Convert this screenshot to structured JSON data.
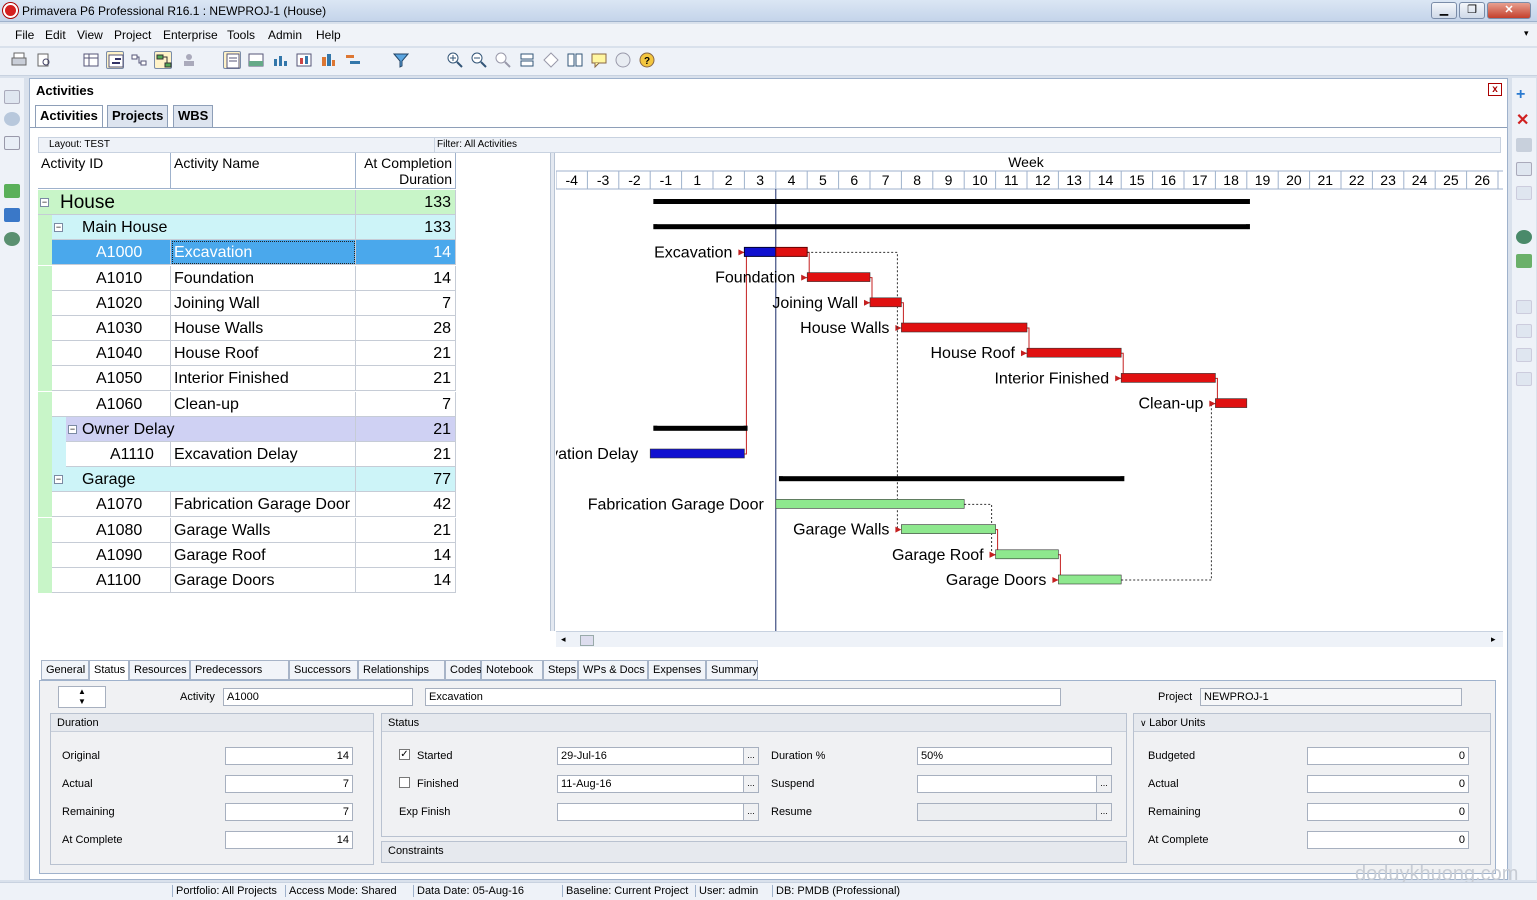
{
  "window": {
    "title": "Primavera P6 Professional R16.1 : NEWPROJ-1 (House)",
    "minimize": "▁",
    "restore": "❐",
    "close": "✕"
  },
  "menu": [
    "File",
    "Edit",
    "View",
    "Project",
    "Enterprise",
    "Tools",
    "Admin",
    "Help"
  ],
  "panel": {
    "title": "Activities",
    "close": "x",
    "tabs": [
      "Activities",
      "Projects",
      "WBS"
    ]
  },
  "layout": {
    "layout_label": "Layout: TEST",
    "filter_label": "Filter: All Activities"
  },
  "columns": {
    "id": "Activity ID",
    "name": "Activity Name",
    "duration": "At Completion Duration"
  },
  "rows": [
    {
      "type": "wbs",
      "level": 0,
      "label": "House",
      "dur": "133",
      "color": "#c8f5c8"
    },
    {
      "type": "wbs",
      "level": 1,
      "label": "Main House",
      "dur": "133",
      "color": "#cdf4f8"
    },
    {
      "type": "act",
      "level": 2,
      "id": "A1000",
      "name": "Excavation",
      "dur": "14",
      "selected": true
    },
    {
      "type": "act",
      "level": 2,
      "id": "A1010",
      "name": "Foundation",
      "dur": "14"
    },
    {
      "type": "act",
      "level": 2,
      "id": "A1020",
      "name": "Joining Wall",
      "dur": "7"
    },
    {
      "type": "act",
      "level": 2,
      "id": "A1030",
      "name": "House Walls",
      "dur": "28"
    },
    {
      "type": "act",
      "level": 2,
      "id": "A1040",
      "name": "House Roof",
      "dur": "21"
    },
    {
      "type": "act",
      "level": 2,
      "id": "A1050",
      "name": "Interior Finished",
      "dur": "21"
    },
    {
      "type": "act",
      "level": 2,
      "id": "A1060",
      "name": "Clean-up",
      "dur": "7"
    },
    {
      "type": "wbs",
      "level": 2,
      "label": "Owner Delay",
      "dur": "21",
      "color": "#cfd1f3"
    },
    {
      "type": "act",
      "level": 3,
      "id": "A1110",
      "name": "Excavation Delay",
      "dur": "21"
    },
    {
      "type": "wbs",
      "level": 1,
      "label": "Garage",
      "dur": "77",
      "color": "#cdf4f8"
    },
    {
      "type": "act",
      "level": 2,
      "id": "A1070",
      "name": "Fabrication Garage Door",
      "dur": "42"
    },
    {
      "type": "act",
      "level": 2,
      "id": "A1080",
      "name": "Garage Walls",
      "dur": "21"
    },
    {
      "type": "act",
      "level": 2,
      "id": "A1090",
      "name": "Garage Roof",
      "dur": "14"
    },
    {
      "type": "act",
      "level": 2,
      "id": "A1100",
      "name": "Garage Doors",
      "dur": "14"
    }
  ],
  "gantt": {
    "timescale_label": "Week",
    "weeks": [
      "-4",
      "-3",
      "-2",
      "-1",
      "1",
      "2",
      "3",
      "4",
      "5",
      "6",
      "7",
      "8",
      "9",
      "10",
      "11",
      "12",
      "13",
      "14",
      "15",
      "16",
      "17",
      "18",
      "19",
      "20",
      "21",
      "22",
      "23",
      "24",
      "25",
      "26",
      "2"
    ],
    "data_date_week": "4",
    "colors": {
      "actual": "#1010d0",
      "remaining": "#e01010",
      "garage": "#8ee88e",
      "summary": "#000000"
    },
    "bars": [
      {
        "row": 0,
        "kind": "summary",
        "start": -1,
        "end": 19
      },
      {
        "row": 1,
        "kind": "summary",
        "start": -1,
        "end": 19
      },
      {
        "row": 2,
        "kind": "split",
        "label": "Excavation",
        "start": 3,
        "mid": 4,
        "end": 5
      },
      {
        "row": 3,
        "kind": "remaining",
        "label": "Foundation",
        "start": 5,
        "end": 7
      },
      {
        "row": 4,
        "kind": "remaining",
        "label": "Joining Wall",
        "start": 7,
        "end": 8
      },
      {
        "row": 5,
        "kind": "remaining",
        "label": "House Walls",
        "start": 8,
        "end": 12
      },
      {
        "row": 6,
        "kind": "remaining",
        "label": "House Roof",
        "start": 12,
        "end": 15
      },
      {
        "row": 7,
        "kind": "remaining",
        "label": "Interior Finished",
        "start": 15,
        "end": 18
      },
      {
        "row": 8,
        "kind": "remaining",
        "label": "Clean-up",
        "start": 18,
        "end": 19
      },
      {
        "row": 9,
        "kind": "summary",
        "start": -1,
        "end": 3
      },
      {
        "row": 10,
        "kind": "actual",
        "label": "avation Delay",
        "start": -1,
        "end": 3
      },
      {
        "row": 11,
        "kind": "summary",
        "start": 4,
        "end": 15
      },
      {
        "row": 12,
        "kind": "garage",
        "label": "Fabrication Garage Door",
        "start": 4,
        "end": 10
      },
      {
        "row": 13,
        "kind": "garage",
        "label": "Garage Walls",
        "start": 8,
        "end": 11
      },
      {
        "row": 14,
        "kind": "garage",
        "label": "Garage Roof",
        "start": 11,
        "end": 13
      },
      {
        "row": 15,
        "kind": "garage",
        "label": "Garage Doors",
        "start": 13,
        "end": 15
      }
    ],
    "links": [
      [
        10,
        2
      ],
      [
        2,
        3
      ],
      [
        3,
        4
      ],
      [
        4,
        5
      ],
      [
        5,
        6
      ],
      [
        6,
        7
      ],
      [
        7,
        8
      ],
      [
        2,
        13
      ],
      [
        12,
        14
      ],
      [
        13,
        14
      ],
      [
        14,
        15
      ],
      [
        15,
        8
      ]
    ]
  },
  "detail": {
    "tabs": [
      "General",
      "Status",
      "Resources",
      "Predecessors",
      "Successors",
      "Relationships",
      "Codes",
      "Notebook",
      "Steps",
      "WPs & Docs",
      "Expenses",
      "Summary"
    ],
    "activity_label": "Activity",
    "activity_id": "A1000",
    "activity_name": "Excavation",
    "project_label": "Project",
    "project": "NEWPROJ-1",
    "duration": {
      "title": "Duration",
      "original_label": "Original",
      "original": "14",
      "actual_label": "Actual",
      "actual": "7",
      "remaining_label": "Remaining",
      "remaining": "7",
      "at_complete_label": "At Complete",
      "at_complete": "14"
    },
    "status": {
      "title": "Status",
      "started_label": "Started",
      "started": true,
      "started_date": "29-Jul-16",
      "finished_label": "Finished",
      "finished": false,
      "finished_date": "11-Aug-16",
      "exp_finish_label": "Exp Finish",
      "exp_finish": "",
      "duration_pct_label": "Duration %",
      "duration_pct": "50%",
      "suspend_label": "Suspend",
      "suspend": "",
      "resume_label": "Resume",
      "resume": "",
      "constraints_label": "Constraints"
    },
    "labor": {
      "title": "Labor Units",
      "budgeted_label": "Budgeted",
      "budgeted": "0",
      "actual_label": "Actual",
      "actual": "0",
      "remaining_label": "Remaining",
      "remaining": "0",
      "at_complete_label": "At Complete",
      "at_complete": "0"
    }
  },
  "statusbar": {
    "portfolio": "Portfolio: All Projects",
    "access": "Access Mode: Shared",
    "data_date": "Data Date: 05-Aug-16",
    "baseline": "Baseline: Current Project",
    "user": "User: admin",
    "db": "DB: PMDB (Professional)"
  },
  "watermark": "doduykhuong.com"
}
